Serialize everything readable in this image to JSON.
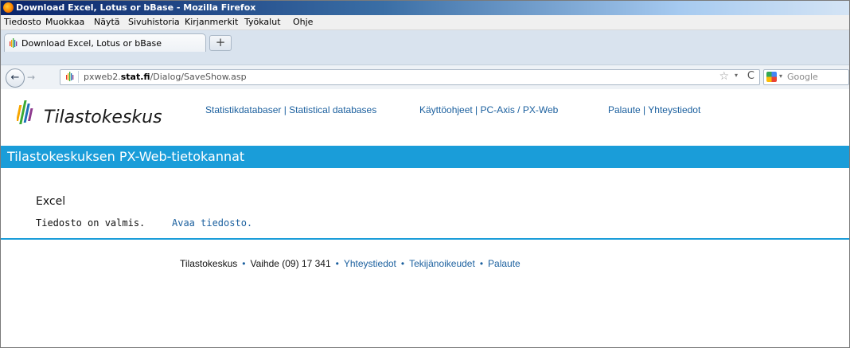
{
  "window": {
    "title": "Download Excel, Lotus or bBase - Mozilla Firefox"
  },
  "menu": {
    "items": [
      "Tiedosto",
      "Muokkaa",
      "Näytä",
      "Sivuhistoria",
      "Kirjanmerkit",
      "Työkalut",
      "Ohje"
    ]
  },
  "tabs": {
    "active_label": "Download Excel, Lotus or bBase",
    "new_tab_label": "+"
  },
  "navbar": {
    "back_glyph": "←",
    "forward_glyph": "→",
    "url_prefix": "pxweb2.",
    "url_domain": "stat.fi",
    "url_path": "/Dialog/SaveShow.asp",
    "star_glyph": "☆",
    "dropdown_glyph": "▾",
    "reload_glyph": "C",
    "search_placeholder": "Google",
    "search_dropdown_glyph": "▾"
  },
  "site": {
    "logo_text": "Tilastokeskus",
    "top_links": {
      "statdb": "Statistikdatabaser | Statistical databases",
      "guide": "Käyttöohjeet | PC-Axis / PX-Web",
      "feedback": "Palaute | Yhteystiedot"
    },
    "banner_title": "Tilastokeskuksen PX-Web-tietokannat"
  },
  "content": {
    "heading": "Excel",
    "ready_text": "Tiedosto on valmis.",
    "open_link": "Avaa tiedosto."
  },
  "footer": {
    "org": "Tilastokeskus",
    "phone": "Vaihde (09) 17 341",
    "contacts": "Yhteystiedot",
    "copyright": "Tekijänoikeudet",
    "feedback": "Palaute",
    "separator": "•"
  },
  "colors": {
    "banner_blue": "#1a9dd9",
    "link_blue": "#1a5f9e"
  }
}
